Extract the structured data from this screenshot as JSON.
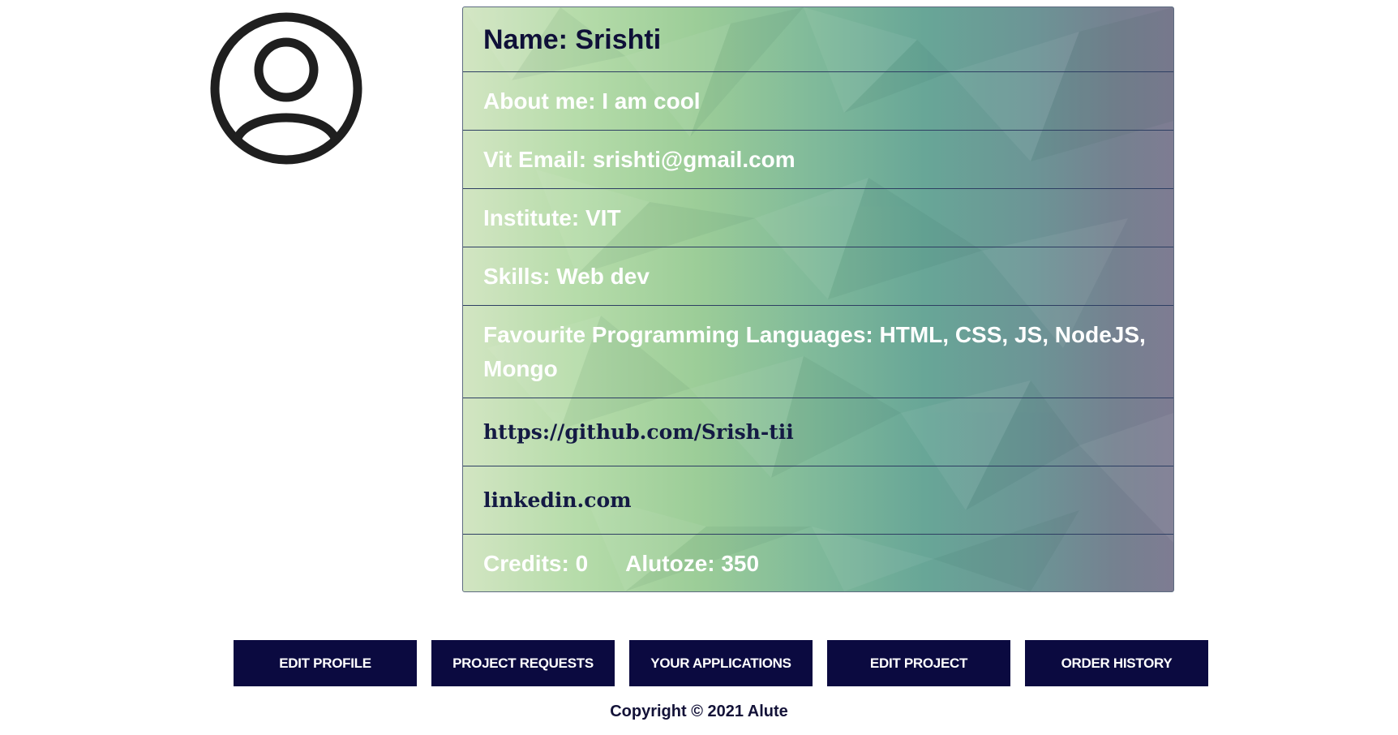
{
  "profile": {
    "avatar_icon": "user-circle-icon",
    "name": "Name: Srishti",
    "about": "About me: I am cool",
    "email": "Vit Email: srishti@gmail.com",
    "institute": "Institute: VIT",
    "skills": "Skills: Web dev",
    "languages": "Favourite Programming Languages: HTML, CSS, JS, NodeJS, Mongo",
    "github": "https://github.com/Srish-tii",
    "linkedin": "linkedin.com",
    "credits": "Credits: 0",
    "alutoze": "Alutoze: 350"
  },
  "actions": {
    "edit_profile": "EDIT PROFILE",
    "project_requests": "PROJECT REQUESTS",
    "your_applications": "YOUR APPLICATIONS",
    "edit_project": "EDIT PROJECT",
    "order_history": "ORDER HISTORY"
  },
  "footer": {
    "copyright": "Copyright © 2021 Alute"
  },
  "colors": {
    "button_bg": "#0b0a40",
    "name_text": "#0f1038",
    "row_divider": "#2e3f63"
  }
}
